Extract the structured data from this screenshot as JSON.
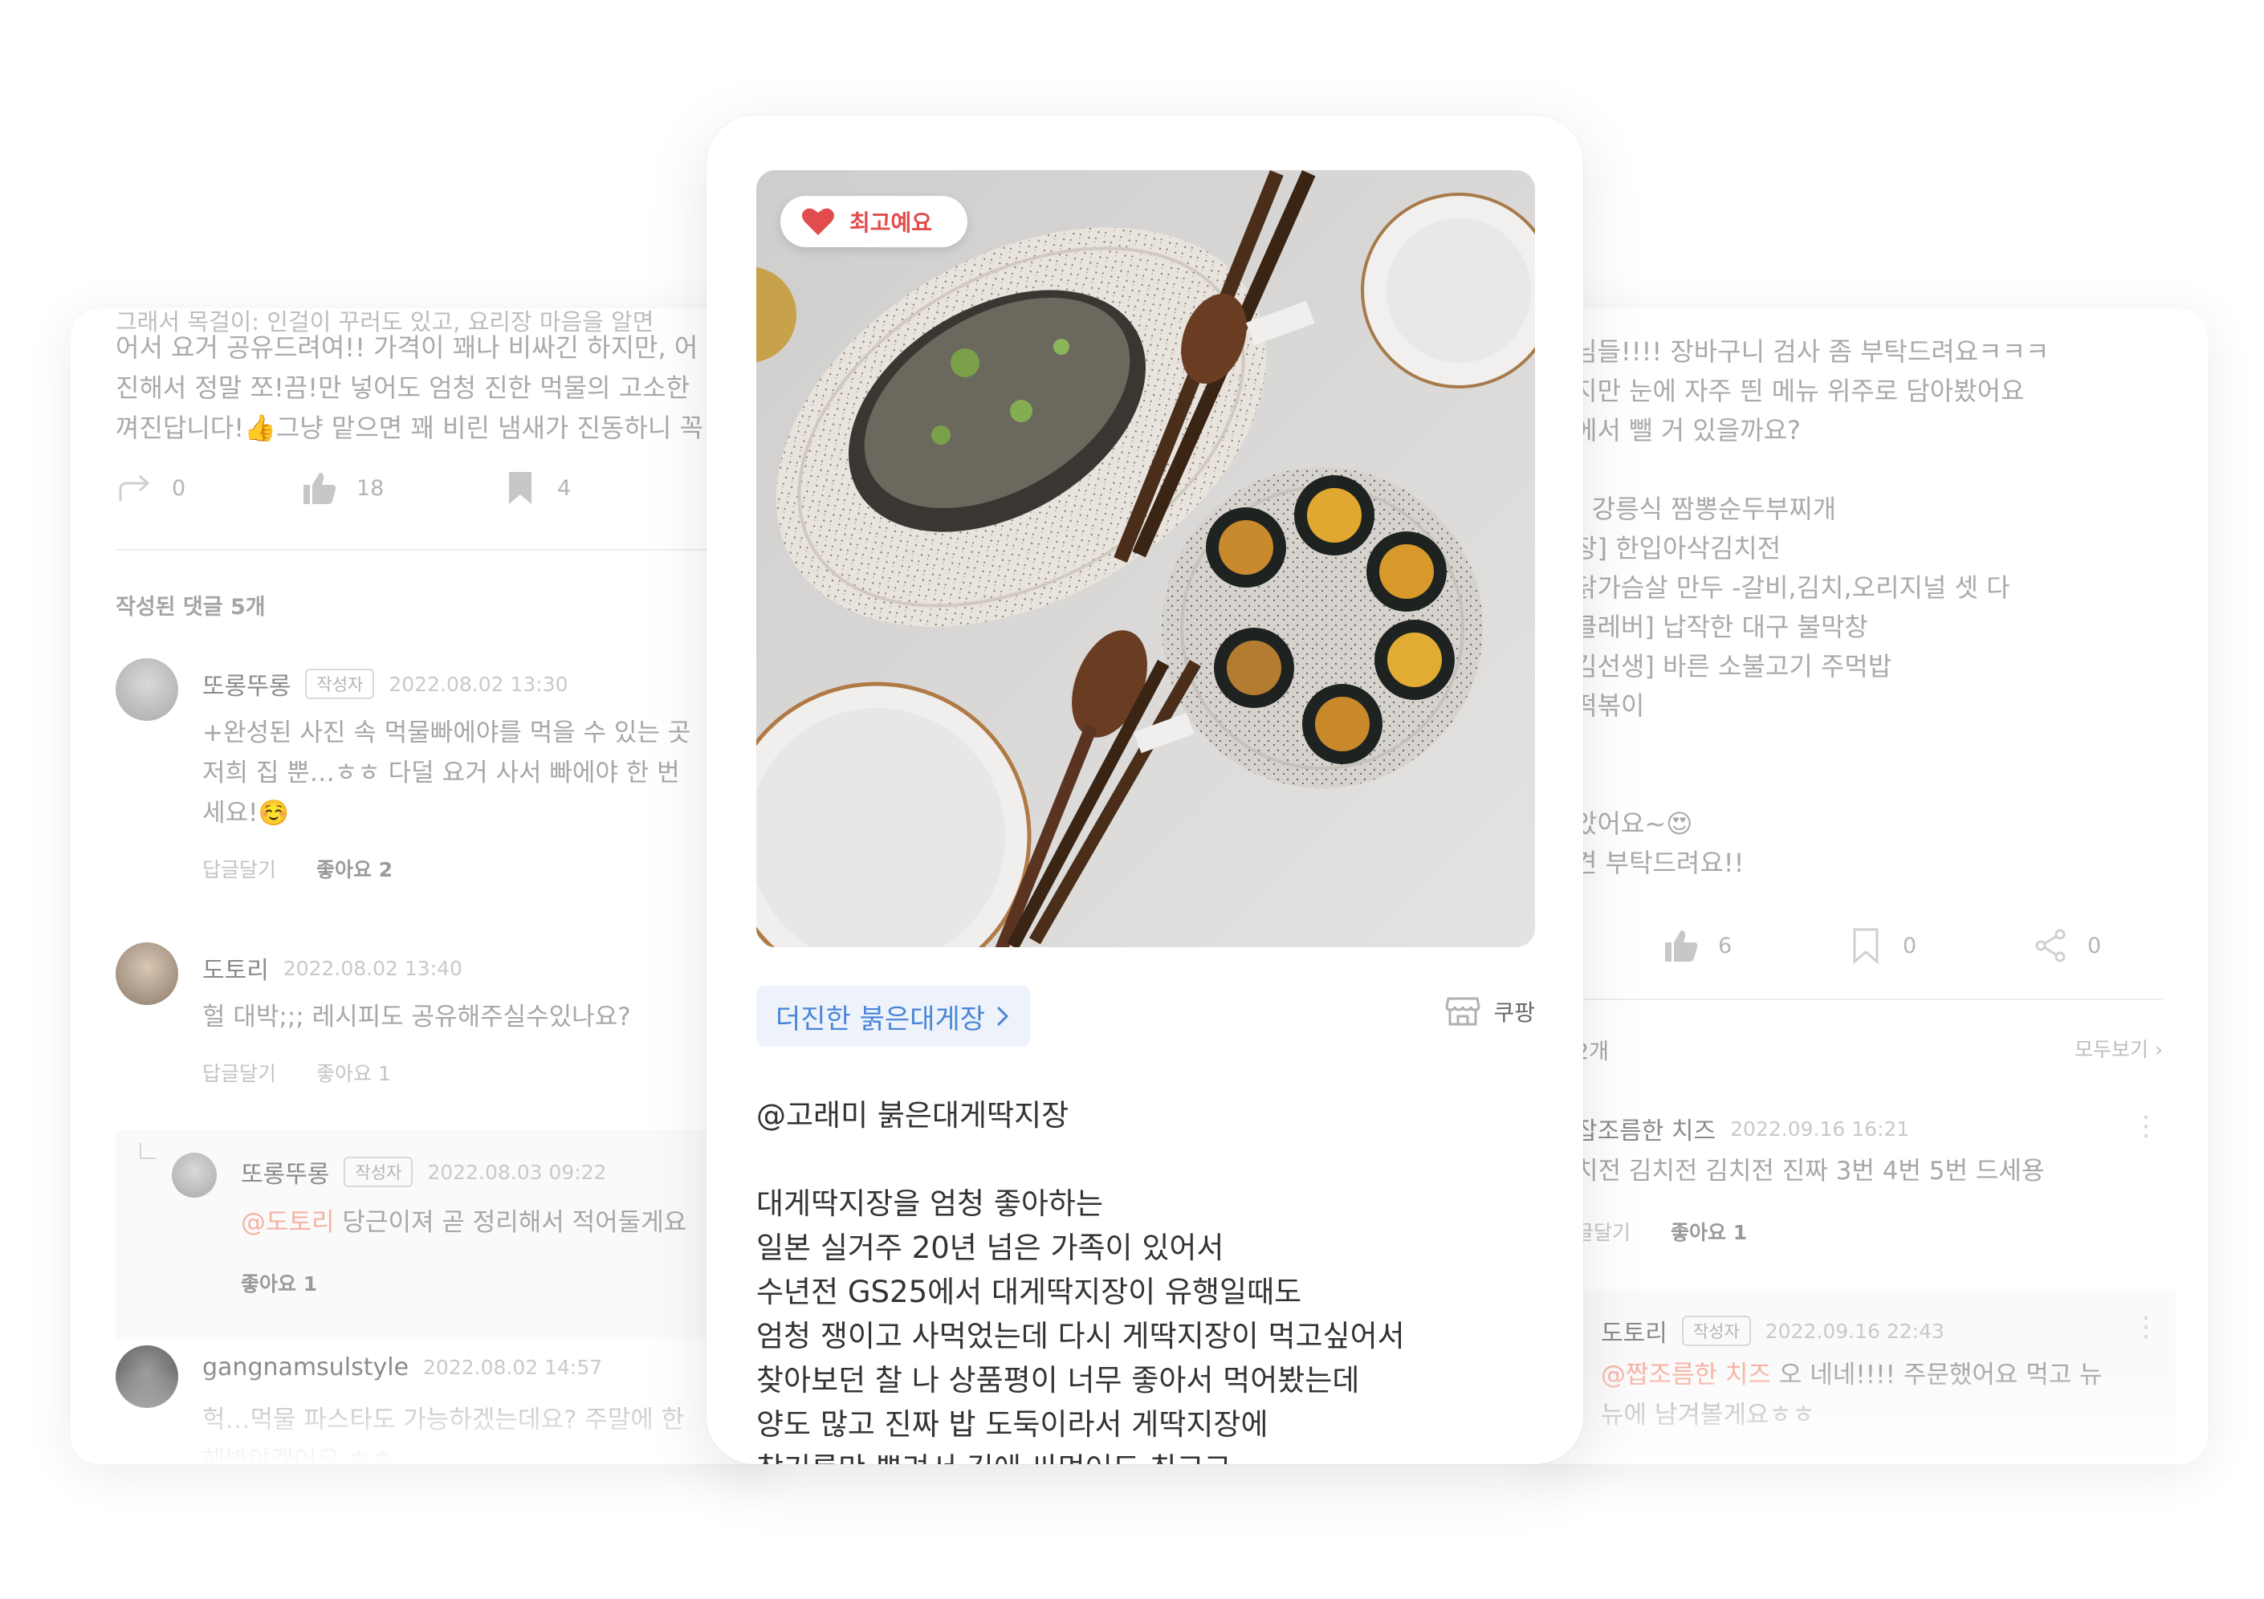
{
  "left_card": {
    "post_text": {
      "cut_line": "그래서 목걸이: 인걸이 꾸러도 있고, 요리장 마음을 알면",
      "lines": [
        "어서 요거 공유드려여!! 가격이 꽤나 비싸긴 하지만, 어",
        "진해서 정말 쪼!끔!만 넣어도 엄청 진한 먹물의 고소한",
        "껴진답니다!👍그냥 맡으면 꽤 비린 냄새가 진동하니 꼭"
      ]
    },
    "actions": {
      "share_count": "0",
      "like_count": "18",
      "bookmark_count": "4"
    },
    "comments_label": "작성된 댓글 5개",
    "comments": [
      {
        "name": "또롱뚜롱",
        "badge": "작성자",
        "date": "2022.08.02 13:30",
        "lines": [
          "+완성된 사진 속 먹물빠에야를 먹을 수 있는 곳",
          "저희 집 뿐…ㅎㅎ 다덜 요거 사서 빠에야 한 번",
          "세요!☺️"
        ],
        "reply": "답글달기",
        "likes": "좋아요 2"
      },
      {
        "name": "도토리",
        "date": "2022.08.02 13:40",
        "lines": [
          "헐 대박;;; 레시피도 공유해주실수있나요?"
        ],
        "reply": "답글달기",
        "likes": "좋아요 1"
      },
      {
        "name": "또롱뚜롱",
        "badge": "작성자",
        "date": "2022.08.03 09:22",
        "mention": "@도토리",
        "text": " 당근이져 곧 정리해서 적어둘게요",
        "likes": "좋아요 1"
      },
      {
        "name": "gangnamsulstyle",
        "date": "2022.08.02 14:57",
        "lines": [
          "헉…먹물 파스타도 가능하겠는데요? 주말에 한",
          "해봐야겠어요 ㅎㅎ"
        ]
      }
    ]
  },
  "center_card": {
    "badge_label": "최고예요",
    "product_name": "더진한 붉은대게장",
    "store_name": "쿠팡",
    "body_lines": [
      "@고래미 붉은대게딱지장",
      "",
      "대게딱지장을 엄청 좋아하는",
      "일본 실거주 20년 넘은 가족이 있어서",
      "수년전 GS25에서 대게딱지장이 유행일때도",
      "엄청 쟁이고 사먹었는데 다시 게딱지장이 먹고싶어서",
      "찾아보던 찰 나 상품평이 너무 좋아서 먹어봤는데",
      "양도 많고 진짜 밥 도둑이라서 게딱지장에",
      "참기름만 뿌려서 김에 싸먹어도 최고고"
    ]
  },
  "right_card": {
    "post_lines": [
      "님들!!!! 장바구니 검사 좀 부탁드려요ㅋㅋㅋ",
      "지만 눈에 자주 띈 메뉴 위주로 담아봤어요",
      "에서 뺄 거 있을까요?",
      "",
      "] 강릉식 짬뽕순두부찌개",
      "장] 한입아삭김치전",
      "닭가슴살 만두 -갈비,김치,오리지널 셋 다",
      "클레버] 납작한 대구 불막창",
      "김선생] 바른 소불고기 주먹밥",
      "떡볶이",
      "",
      "",
      "았어요~😍",
      "견 부탁드려요!!"
    ],
    "actions": {
      "like_count": "6",
      "bookmark_count": "0",
      "share_count": "0"
    },
    "comments_label": "2개",
    "see_all": "모두보기",
    "comments": [
      {
        "name": "잡조름한 치즈",
        "date": "2022.09.16 16:21",
        "text": "치전 김치전 김치전 진짜 3번 4번 5번 드세용",
        "reply": "글달기",
        "likes": "좋아요 1"
      },
      {
        "name": "도토리",
        "badge": "작성자",
        "date": "2022.09.16 22:43",
        "mention": "@짭조름한 치즈",
        "text": " 오 네네!!!! 주문했어요 먹고 뉴",
        "text2": "뉴에 남겨볼게요ㅎㅎ"
      }
    ]
  },
  "colors": {
    "accent_blue": "#4a86d8",
    "heart_red": "#e24c4c",
    "mention": "#f5b2a3"
  }
}
